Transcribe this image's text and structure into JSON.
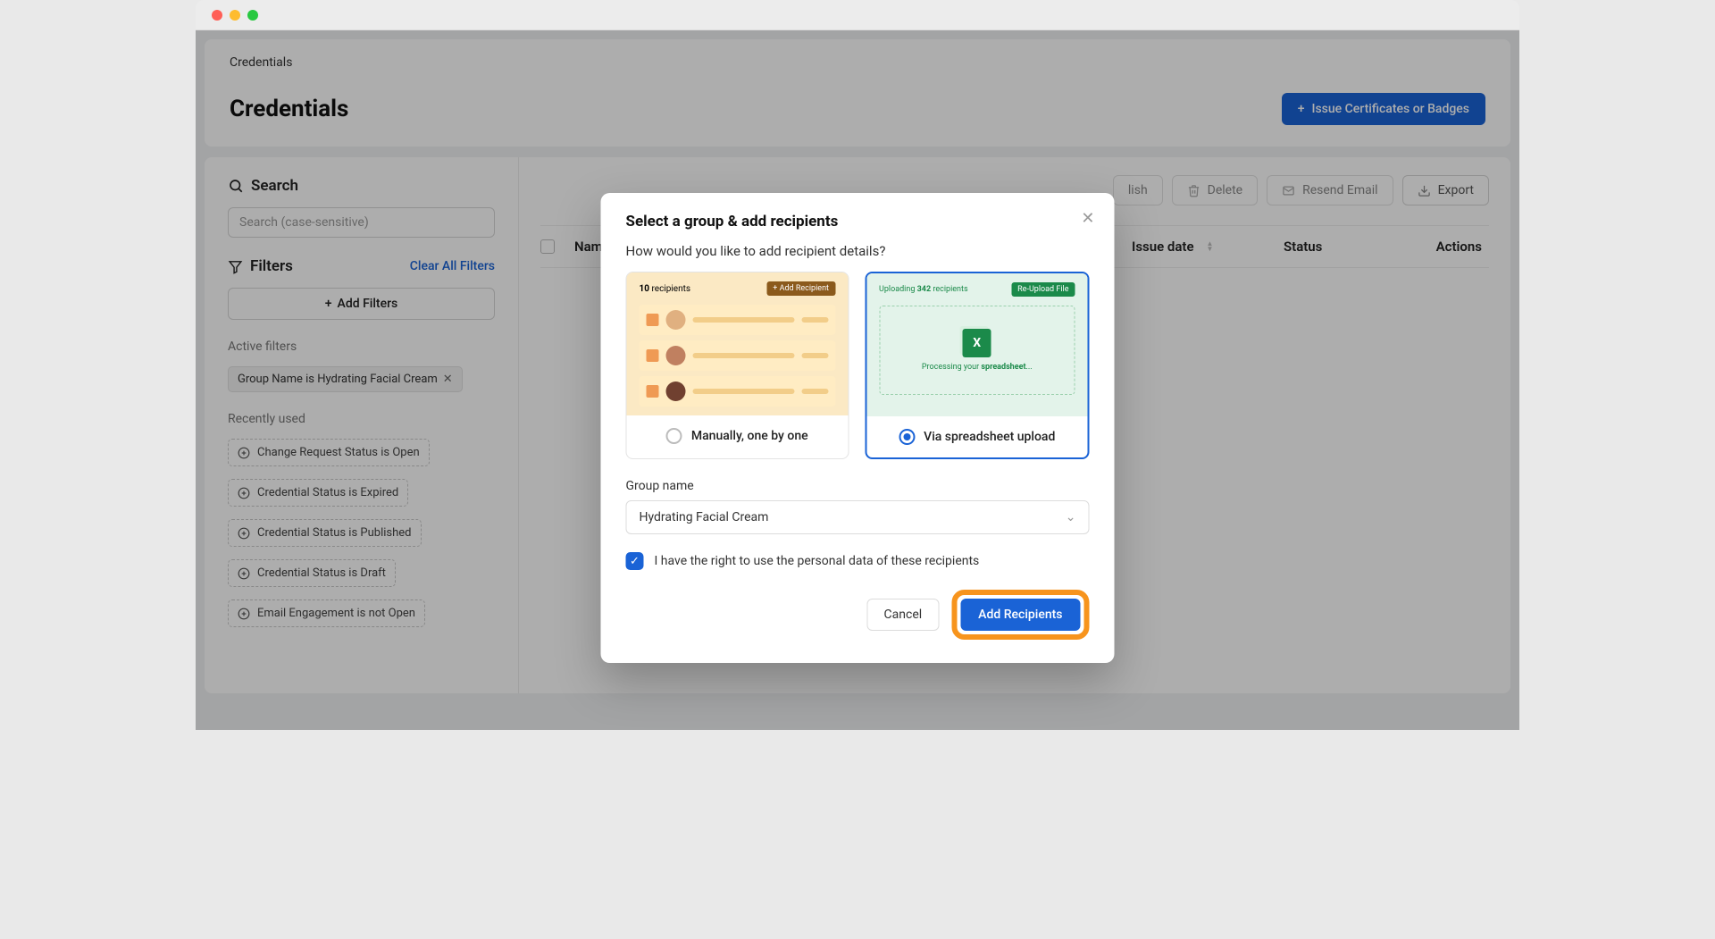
{
  "breadcrumb": "Credentials",
  "page_title": "Credentials",
  "issue_btn": "Issue Certificates or Badges",
  "sidebar": {
    "search_title": "Search",
    "search_placeholder": "Search (case-sensitive)",
    "filters_title": "Filters",
    "clear_all": "Clear All Filters",
    "add_filters": "Add Filters",
    "active_label": "Active filters",
    "active_chip": "Group Name is Hydrating Facial Cream",
    "recent_label": "Recently used",
    "recent": [
      "Change Request Status is Open",
      "Credential Status is Expired",
      "Credential Status is Published",
      "Credential Status is Draft",
      "Email Engagement is not Open"
    ]
  },
  "toolbar": {
    "publish": "lish",
    "delete": "Delete",
    "resend": "Resend Email",
    "export": "Export"
  },
  "table": {
    "name": "Name",
    "issue": "Issue date",
    "status": "Status",
    "actions": "Actions"
  },
  "modal": {
    "title": "Select a group & add recipients",
    "subtitle": "How would you like to add recipient details?",
    "opt_manual": "Manually, one by one",
    "opt_sheet": "Via spreadsheet upload",
    "thumbA_count": "10 recipients",
    "thumbA_add": "+ Add Recipient",
    "thumbB_uploading_prefix": "Uploading ",
    "thumbB_uploading_count": "342",
    "thumbB_uploading_suffix": " recipients",
    "thumbB_pill": "Re-Upload File",
    "thumbB_processing": "Processing your ",
    "thumbB_processing_bold": "spreadsheet",
    "group_name_label": "Group name",
    "group_name_value": "Hydrating Facial Cream",
    "consent": "I have the right to use the personal data of these recipients",
    "cancel": "Cancel",
    "add": "Add Recipients"
  }
}
